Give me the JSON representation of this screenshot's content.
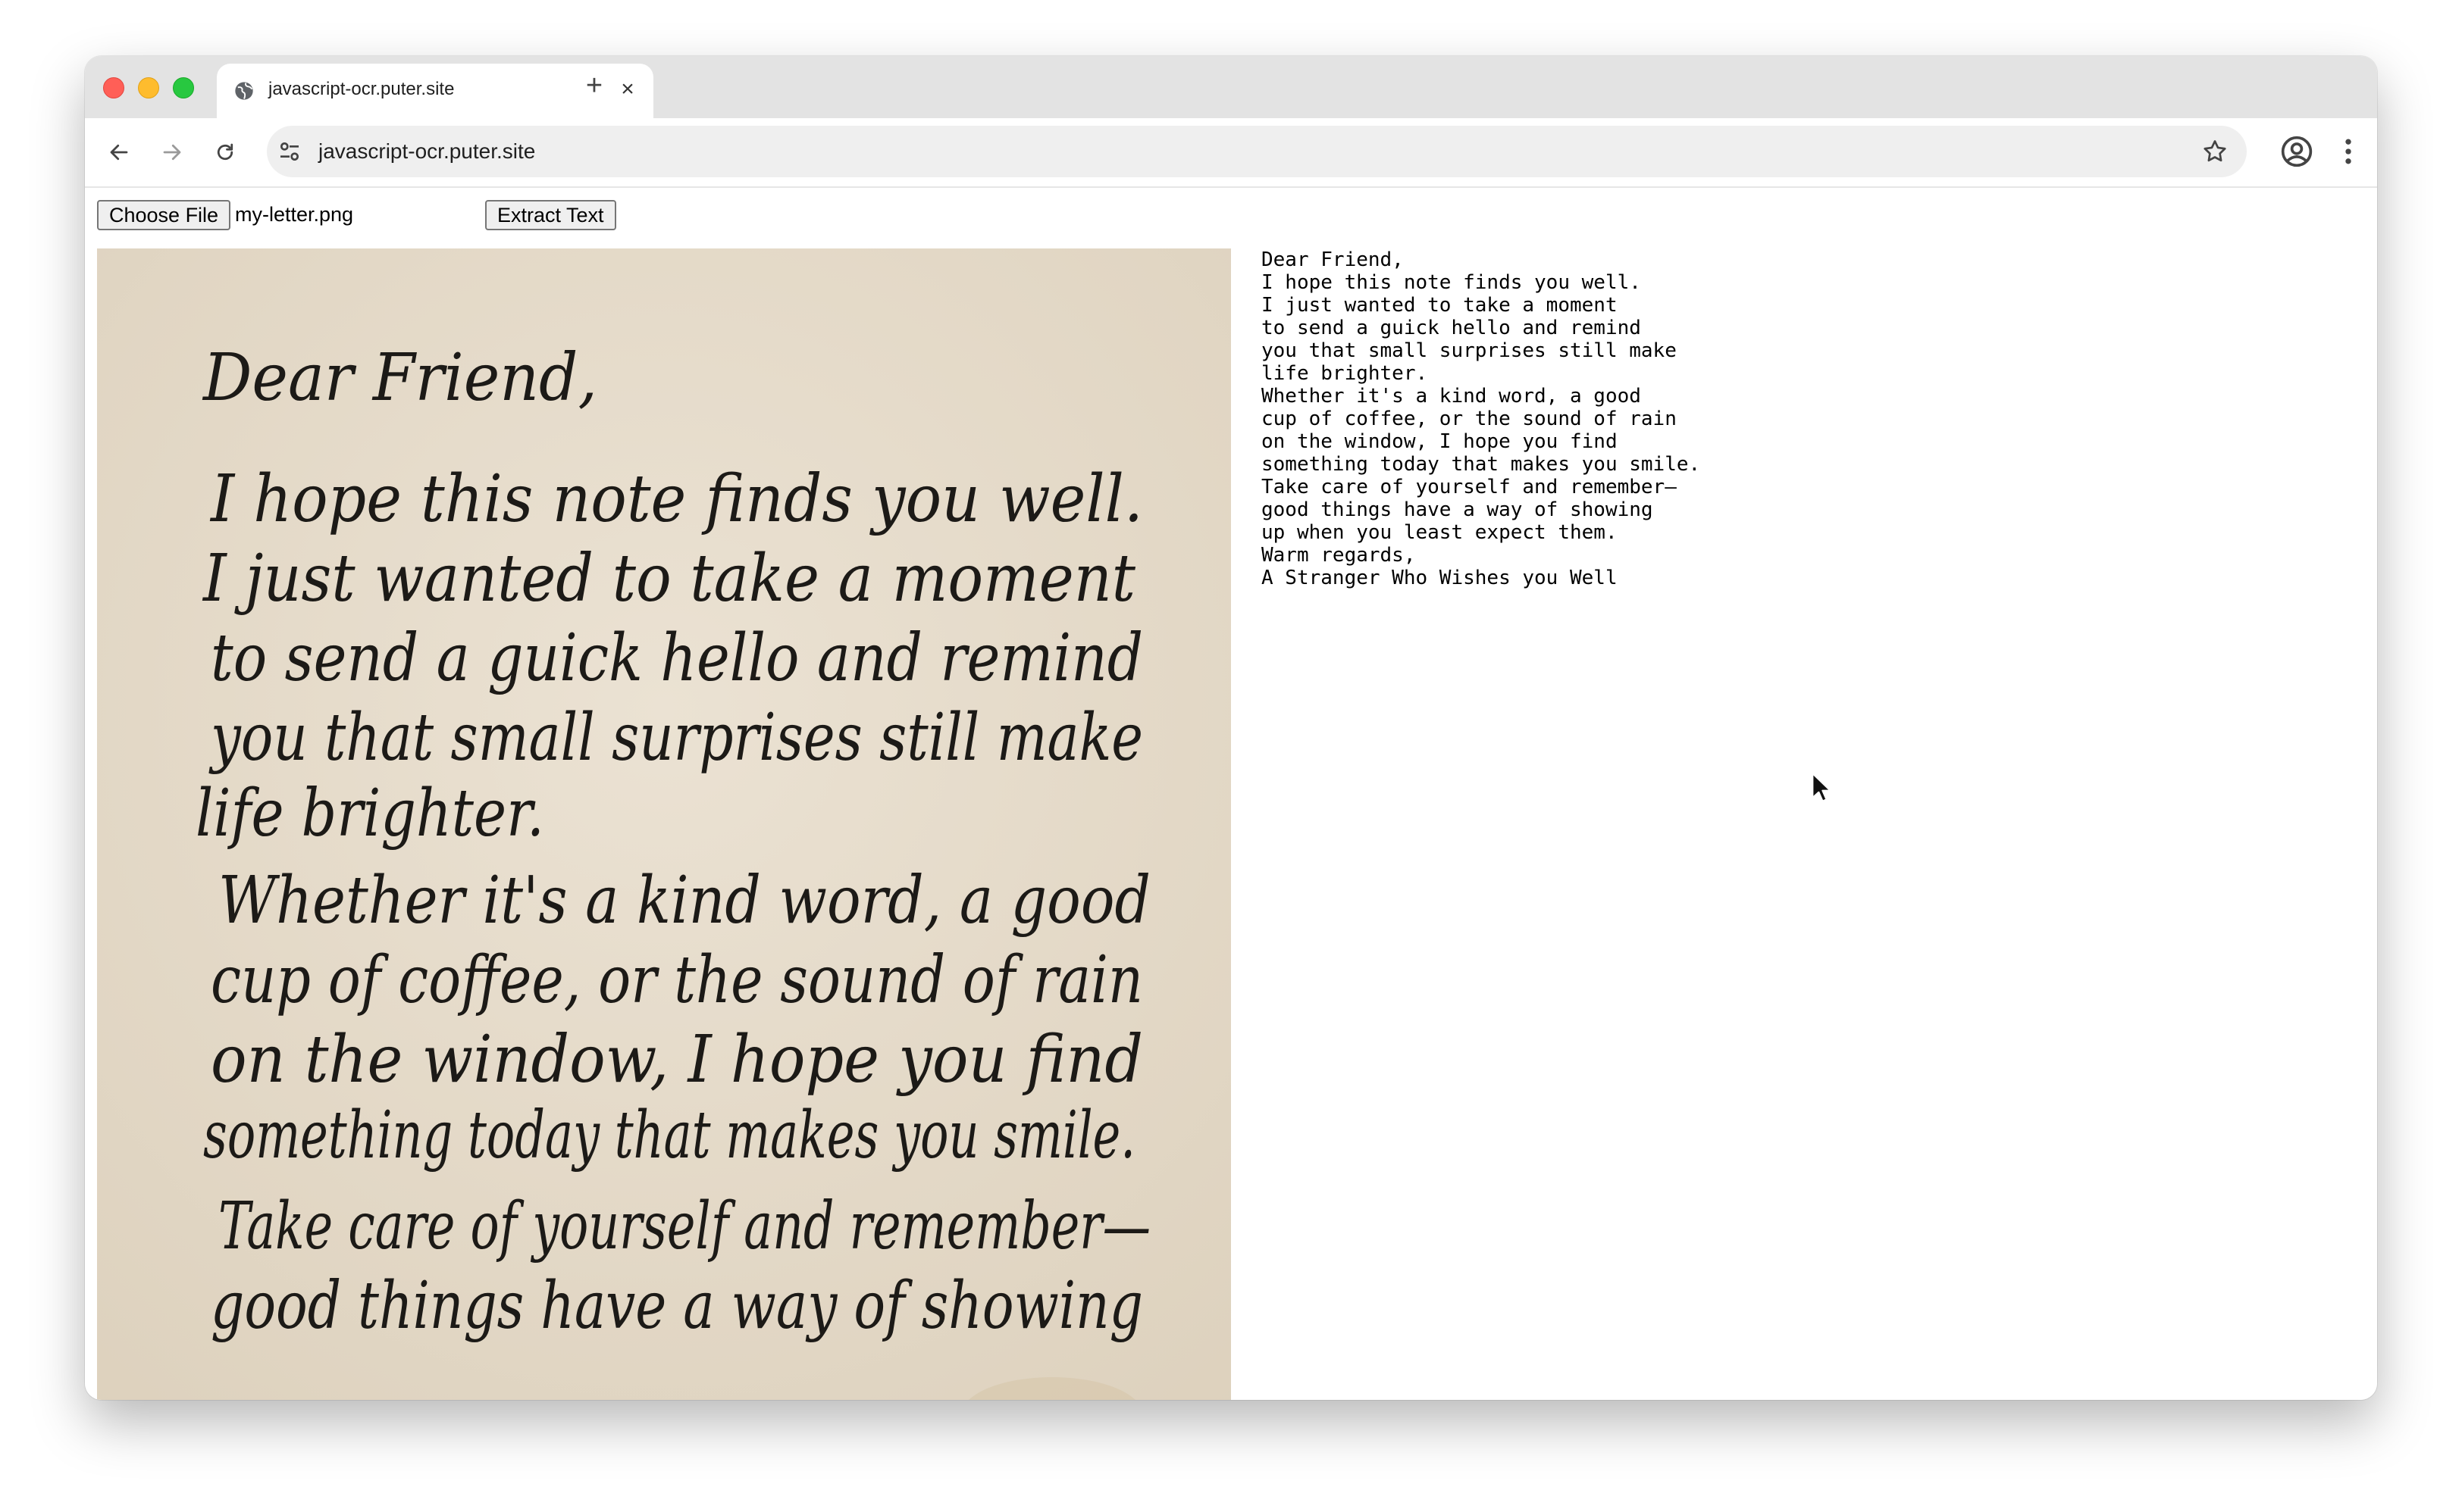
{
  "browser": {
    "tab_title": "javascript-ocr.puter.site",
    "url": "javascript-ocr.puter.site"
  },
  "page": {
    "choose_file_label": "Choose File",
    "file_name": "my-letter.png",
    "extract_label": "Extract Text"
  },
  "letter_image": {
    "lines": [
      "Dear Friend,",
      "I hope this note finds you well.",
      "I just wanted to take a moment",
      "to send a guick hello and remind",
      "you that small surprises still make",
      "life brighter.",
      "Whether it's a kind word, a good",
      "cup of coffee, or the sound of rain",
      "on the window, I hope you find",
      "something today that makes you smile.",
      "Take care of yourself and remember—",
      "good things have a way of showing"
    ]
  },
  "ocr_output": {
    "lines": [
      "Dear Friend,",
      "I hope this note finds you well.",
      "I just wanted to take a moment",
      "to send a guick hello and remind",
      "you that small surprises still make",
      "life brighter.",
      "Whether it's a kind word, a good",
      "cup of coffee, or the sound of rain",
      "on the window, I hope you find",
      "something today that makes you smile.",
      "Take care of yourself and remember—",
      "good things have a way of showing",
      "up when you least expect them.",
      "Warm regards,",
      "A Stranger Who Wishes you Well"
    ]
  },
  "icons": {
    "tab_favicon": "globe-icon",
    "back": "arrow-left-icon",
    "forward": "arrow-right-icon",
    "reload": "reload-icon",
    "site_info": "tune-icon",
    "bookmark": "star-icon",
    "profile": "profile-icon",
    "menu": "kebab-menu-icon",
    "cursor": "mouse-pointer-icon"
  },
  "colors": {
    "paper": "#e6dccb",
    "ink": "#1c1a17",
    "close_dot": "#ff5f57",
    "minimize_dot": "#febc2e",
    "zoom_dot": "#28c840"
  }
}
